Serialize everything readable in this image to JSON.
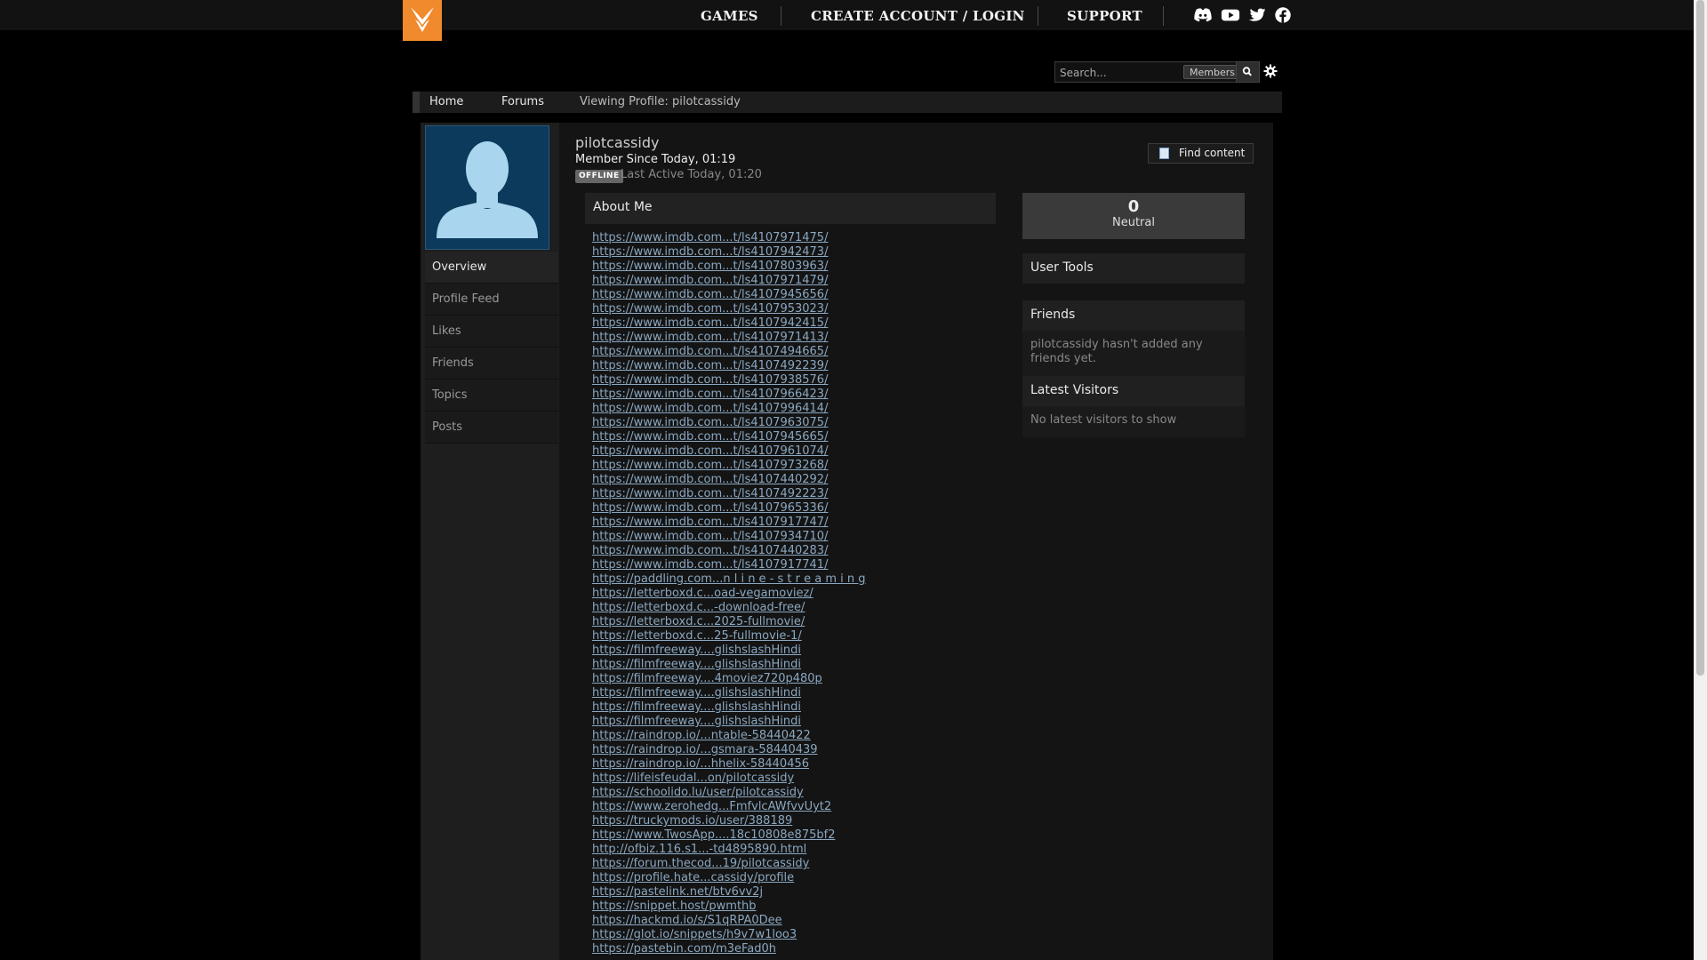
{
  "nav": {
    "items": [
      "GAMES",
      "CREATE ACCOUNT / LOGIN",
      "SUPPORT"
    ],
    "social": [
      "discord-icon",
      "youtube-icon",
      "twitter-icon",
      "facebook-icon"
    ]
  },
  "search": {
    "placeholder": "Search...",
    "scope": "Members"
  },
  "breadcrumb": {
    "home": "Home",
    "forums": "Forums",
    "current": "Viewing Profile: pilotcassidy"
  },
  "profile": {
    "username": "pilotcassidy",
    "member_since": "Member Since Today, 01:19",
    "status": "OFFLINE",
    "last_active": "Last Active Today, 01:20",
    "find_content": "Find content"
  },
  "sidenav": [
    "Overview",
    "Profile Feed",
    "Likes",
    "Friends",
    "Topics",
    "Posts"
  ],
  "about": {
    "title": "About Me",
    "links": [
      "https://www.imdb.com...t/ls4107971475/",
      "https://www.imdb.com...t/ls4107942473/",
      "https://www.imdb.com...t/ls4107803963/",
      "https://www.imdb.com...t/ls4107971479/",
      "https://www.imdb.com...t/ls4107945656/",
      "https://www.imdb.com...t/ls4107953023/",
      "https://www.imdb.com...t/ls4107942415/",
      "https://www.imdb.com...t/ls4107971413/",
      "https://www.imdb.com...t/ls4107494665/",
      "https://www.imdb.com...t/ls4107492239/",
      "https://www.imdb.com...t/ls4107938576/",
      "https://www.imdb.com...t/ls4107966423/",
      "https://www.imdb.com...t/ls4107996414/",
      "https://www.imdb.com...t/ls4107963075/",
      "https://www.imdb.com...t/ls4107945665/",
      "https://www.imdb.com...t/ls4107961074/",
      "https://www.imdb.com...t/ls4107973268/",
      "https://www.imdb.com...t/ls4107440292/",
      "https://www.imdb.com...t/ls4107492223/",
      "https://www.imdb.com...t/ls4107965336/",
      "https://www.imdb.com...t/ls4107917747/",
      "https://www.imdb.com...t/ls4107934710/",
      "https://www.imdb.com...t/ls4107440283/",
      "https://www.imdb.com...t/ls4107917741/",
      "https://paddling.com...n l i n e - s t r e a m i n g",
      "https://letterboxd.c...oad-vegamoviez/",
      "https://letterboxd.c...-download-free/",
      "https://letterboxd.c...2025-fullmovie/",
      "https://letterboxd.c...25-fullmovie-1/",
      "https://filmfreeway....glishslashHindi",
      "https://filmfreeway....glishslashHindi",
      "https://filmfreeway....4moviez720p480p",
      "https://filmfreeway....glishslashHindi",
      "https://filmfreeway....glishslashHindi",
      "https://filmfreeway....glishslashHindi",
      "https://raindrop.io/...ntable-58440422",
      "https://raindrop.io/...gsmara-58440439",
      "https://raindrop.io/...hhelix-58440456",
      "https://lifeisfeudal...on/pilotcassidy",
      "https://schoolido.lu/user/pilotcassidy",
      "https://www.zerohedg...FmfvlcAWfvvUyt2",
      "https://truckymods.io/user/388189",
      "https://www.TwosApp....18c10808e875bf2",
      "http://ofbiz.116.s1...-td4895890.html",
      "https://forum.thecod...19/pilotcassidy",
      "https://profile.hate...cassidy/profile",
      "https://pastelink.net/btv6vv2j",
      "https://snippet.host/pwmthb",
      "https://hackmd.io/s/S1qRPA0Dee",
      "https://glot.io/snippets/h9v7w1loo3",
      "https://pastebin.com/m3eFad0h"
    ]
  },
  "reputation": {
    "value": "0",
    "label": "Neutral"
  },
  "right": {
    "user_tools": "User Tools",
    "friends": "Friends",
    "friends_text": "pilotcassidy hasn't added any friends yet.",
    "visitors": "Latest Visitors",
    "visitors_text": "No latest visitors to show"
  }
}
